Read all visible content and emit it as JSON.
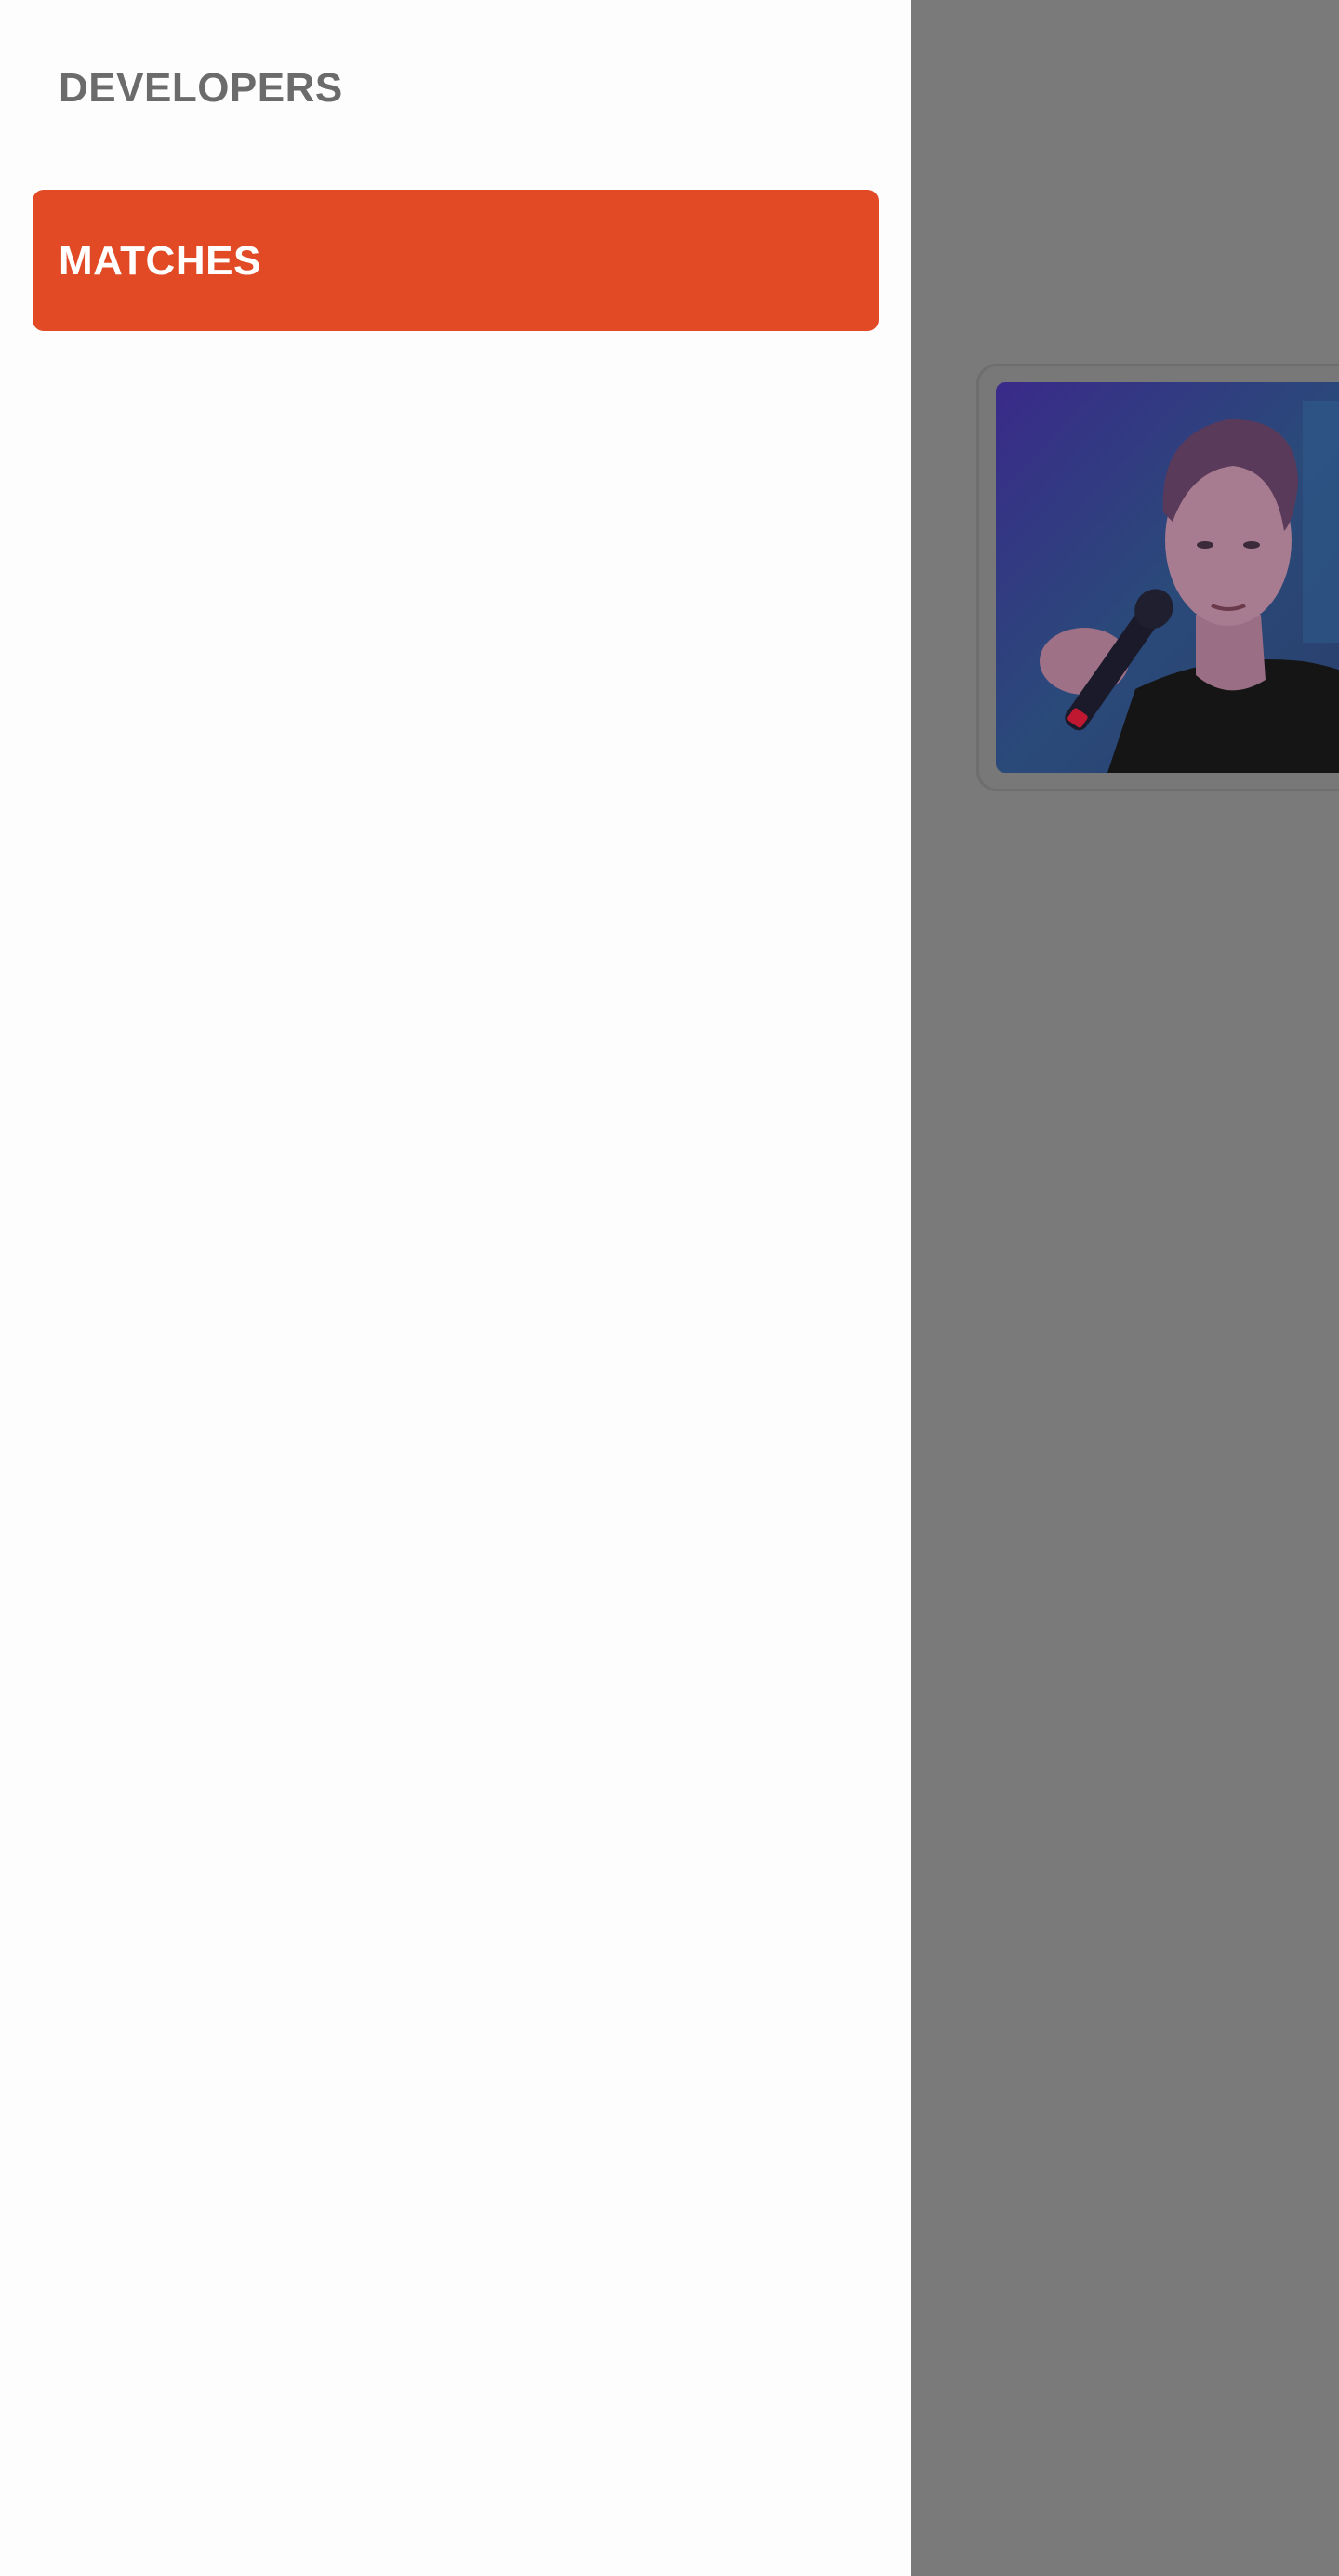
{
  "drawer": {
    "section_header": "DEVELOPERS",
    "items": [
      {
        "label": "MATCHES",
        "selected": true
      }
    ]
  },
  "colors": {
    "accent": "#e14a24",
    "drawer_background": "#fdfdfd",
    "scrim": "#7a7a7a",
    "header_text": "#6b6b6b"
  },
  "icons": {
    "profile_photo": "person-with-microphone-photo"
  }
}
